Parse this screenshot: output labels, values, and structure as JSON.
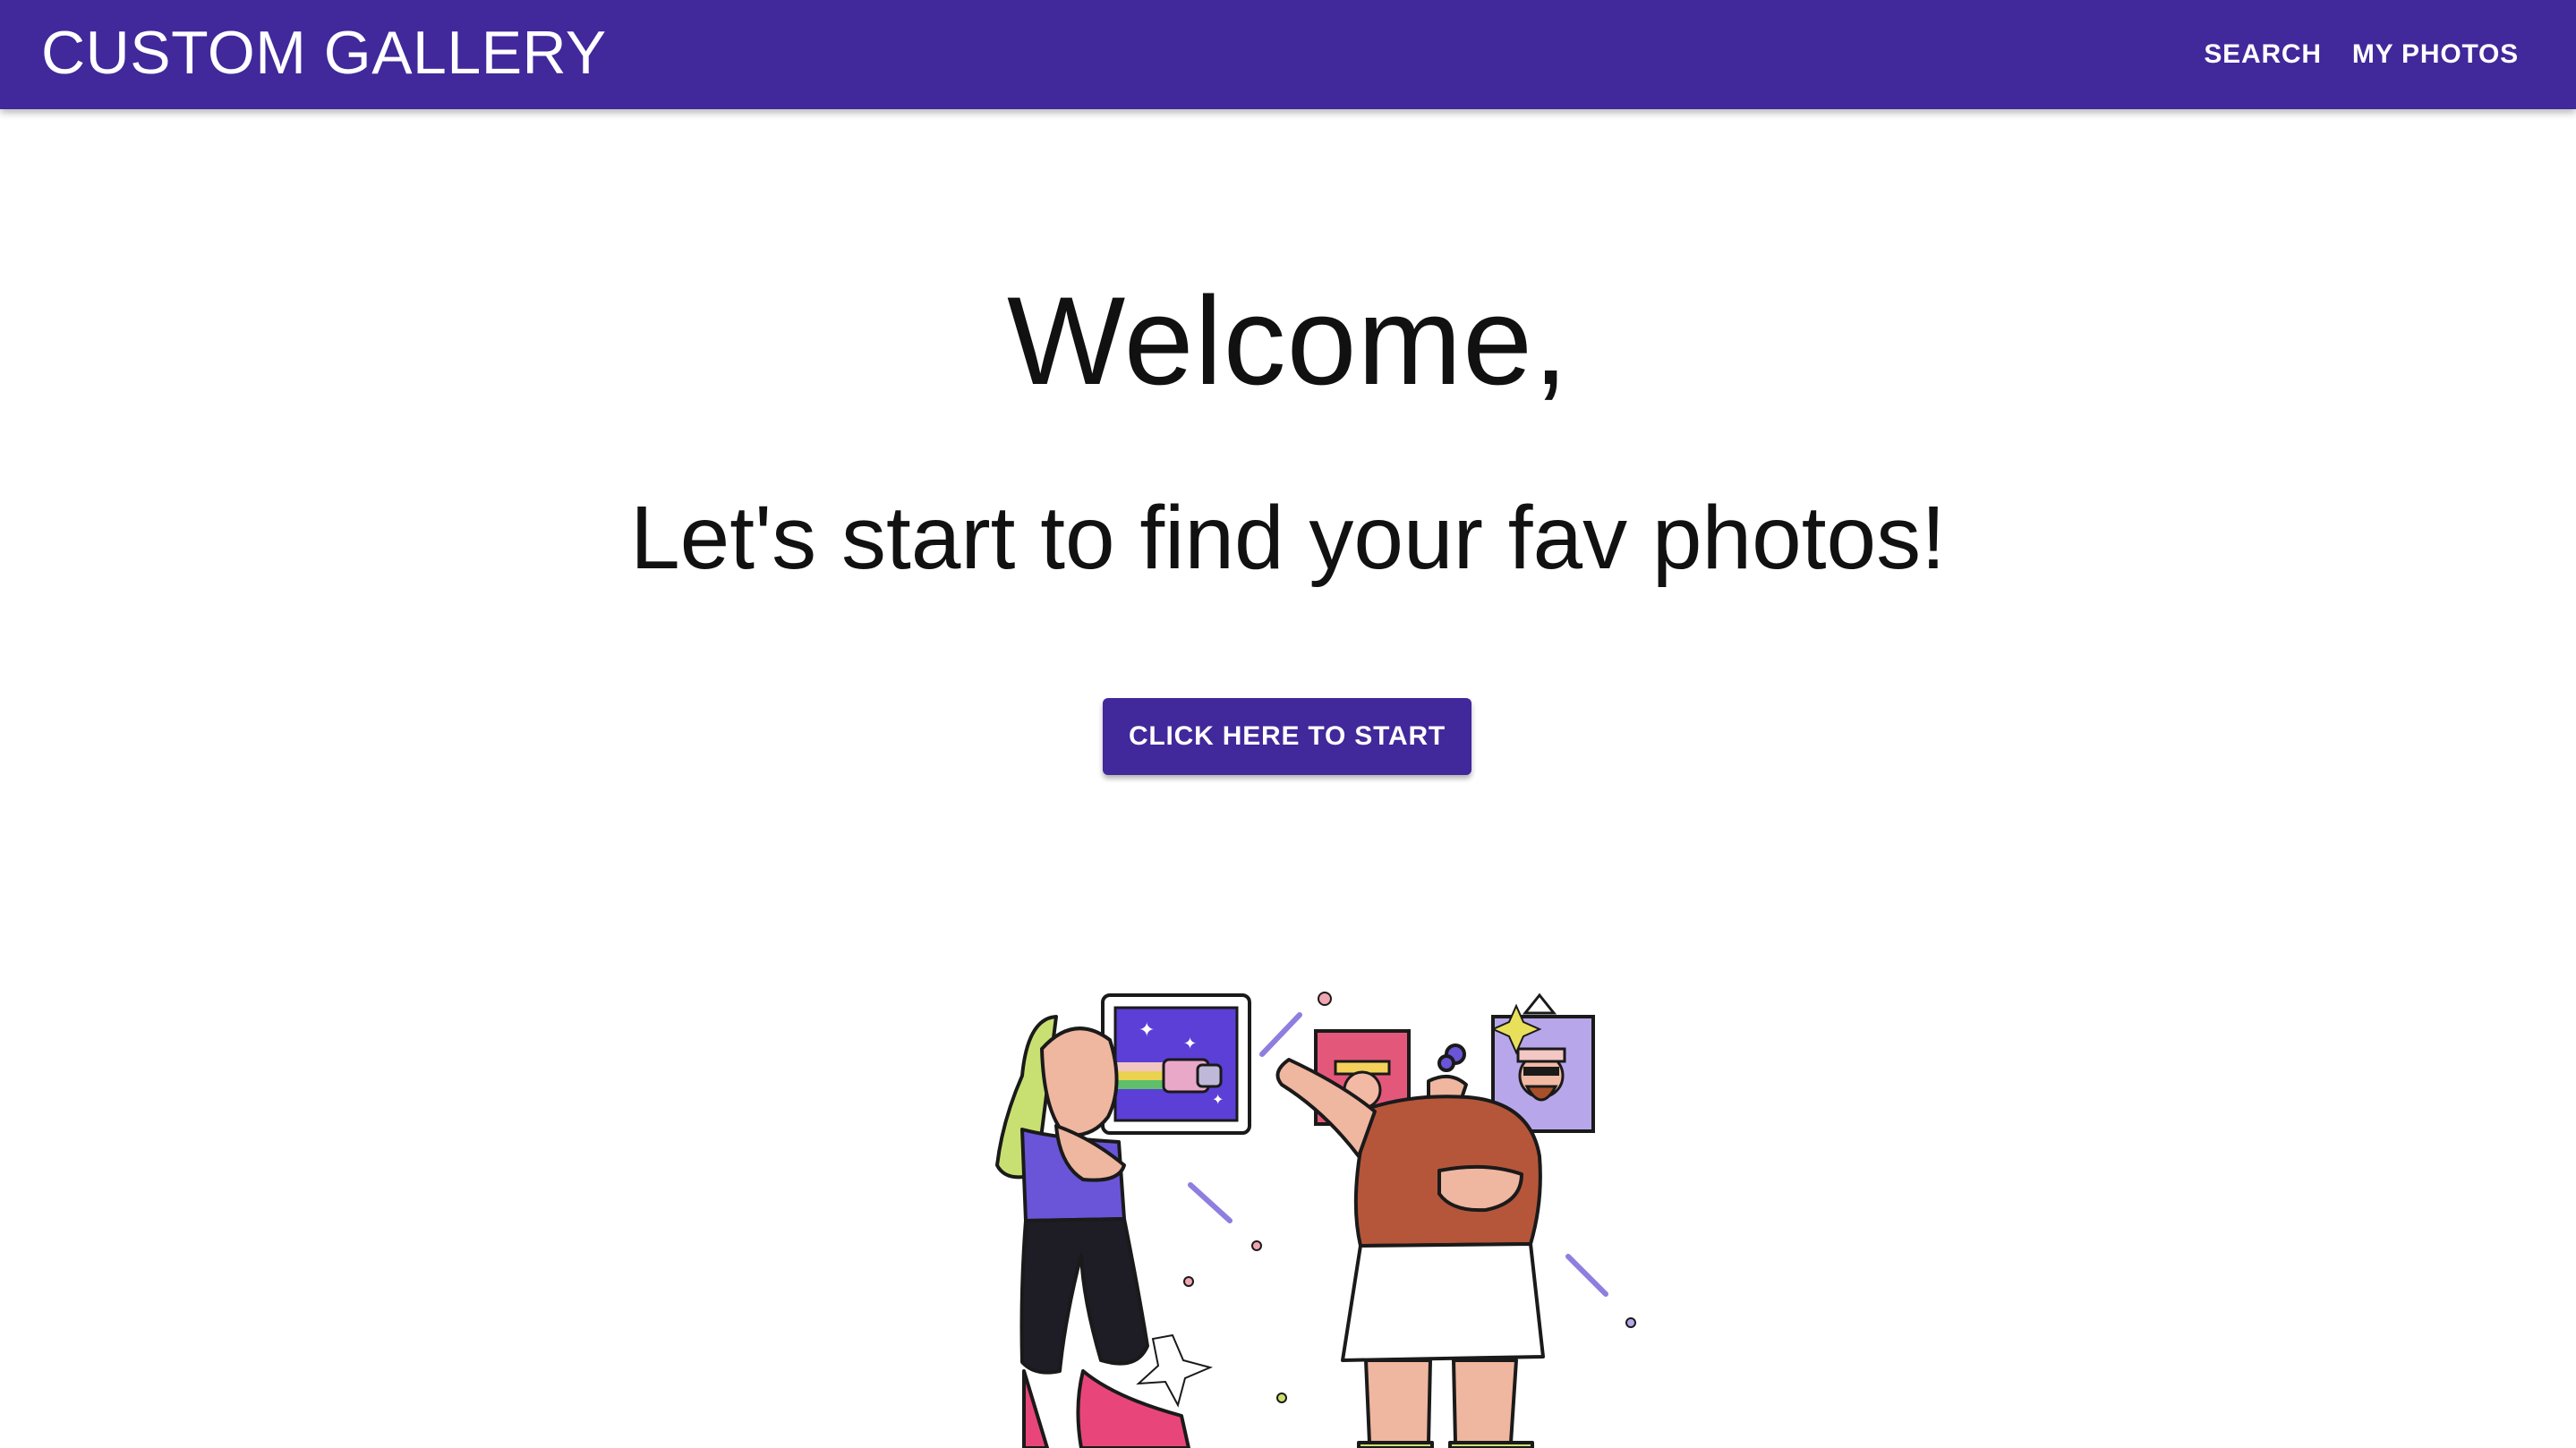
{
  "app": {
    "title": "CUSTOM GALLERY"
  },
  "nav": {
    "items": [
      {
        "label": "SEARCH"
      },
      {
        "label": "MY PHOTOS"
      }
    ]
  },
  "hero": {
    "heading": "Welcome,",
    "subheading": "Let's start to find your fav photos!",
    "cta_label": "CLICK HERE TO START"
  },
  "colors": {
    "primary": "#41289b",
    "text": "#111111",
    "background": "#ffffff"
  }
}
